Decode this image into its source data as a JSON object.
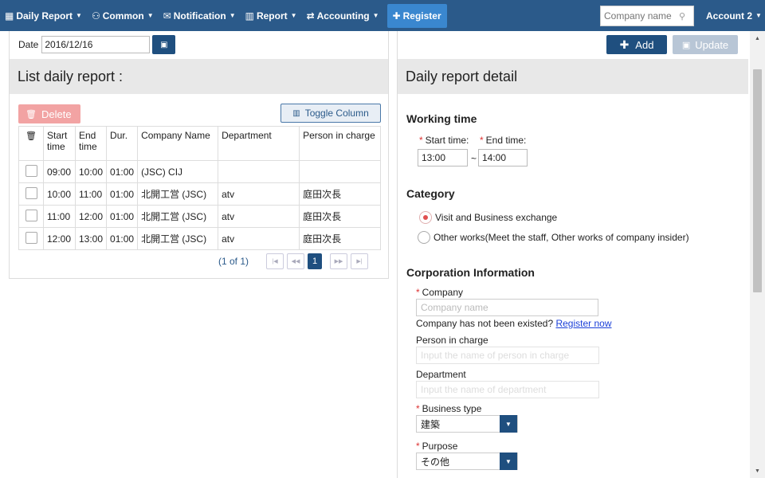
{
  "nav": {
    "items": [
      {
        "label": "Daily Report",
        "icon": "calendar-icon",
        "glyph": "📅"
      },
      {
        "label": "Common",
        "icon": "users-icon",
        "glyph": "⚇"
      },
      {
        "label": "Notification",
        "icon": "envelope-icon",
        "glyph": "✉"
      },
      {
        "label": "Report",
        "icon": "bar-chart-icon",
        "glyph": "▥"
      },
      {
        "label": "Accounting",
        "icon": "exchange-icon",
        "glyph": "⇄"
      }
    ],
    "register_label": "Register",
    "search_placeholder": "Company name",
    "account_label": "Account 2"
  },
  "left": {
    "date_label": "Date",
    "date_value": "2016/12/16",
    "title": "List daily report :",
    "delete_label": "Delete",
    "toggle_label": "Toggle Column",
    "columns": [
      "Start time",
      "End time",
      "Dur.",
      "Company Name",
      "Department",
      "Person in charge"
    ],
    "rows": [
      {
        "start": "09:00",
        "end": "10:00",
        "dur": "01:00",
        "company": "(JSC) CIJ",
        "department": "",
        "person": ""
      },
      {
        "start": "10:00",
        "end": "11:00",
        "dur": "01:00",
        "company": "北開工営 (JSC)",
        "department": "atv",
        "person": "庭田次長"
      },
      {
        "start": "11:00",
        "end": "12:00",
        "dur": "01:00",
        "company": "北開工営 (JSC)",
        "department": "atv",
        "person": "庭田次長"
      },
      {
        "start": "12:00",
        "end": "13:00",
        "dur": "01:00",
        "company": "北開工営 (JSC)",
        "department": "atv",
        "person": "庭田次長"
      }
    ],
    "pager": {
      "info": "(1 of 1)",
      "current": "1"
    }
  },
  "right": {
    "add_label": "Add",
    "update_label": "Update",
    "title": "Daily report detail",
    "working_time": {
      "title": "Working time",
      "start_label": "Start time:",
      "end_label": "End time:",
      "start_value": "13:00",
      "separator": "~",
      "end_value": "14:00"
    },
    "category": {
      "title": "Category",
      "options": [
        {
          "label": "Visit and Business exchange",
          "selected": true
        },
        {
          "label": "Other works(Meet the staff, Other works of company insider)",
          "selected": false
        }
      ]
    },
    "corporation": {
      "title": "Corporation Information",
      "company_label": "Company",
      "company_placeholder": "Company name",
      "not_exist_text": "Company has not been existed?",
      "register_link": "Register now",
      "person_label": "Person in charge",
      "person_placeholder": "Input the name of person in charge",
      "department_label": "Department",
      "department_placeholder": "Input the name of department",
      "business_type_label": "Business type",
      "business_type_value": "建築",
      "purpose_label": "Purpose",
      "purpose_value": "その他"
    }
  }
}
